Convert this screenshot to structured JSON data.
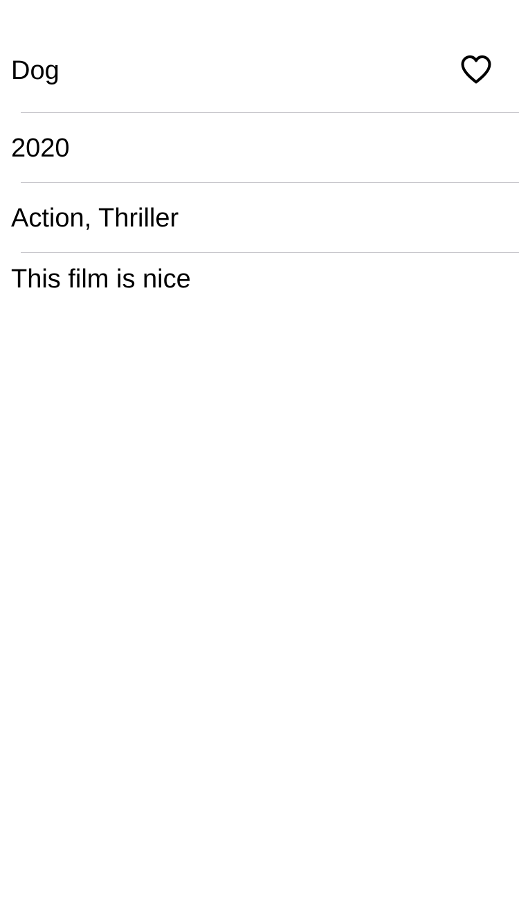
{
  "movie": {
    "title": "Dog",
    "year": "2020",
    "genres": "Action, Thriller",
    "description": "This film is nice"
  },
  "favorite": {
    "icon": "heart-outline-icon",
    "is_favorite": false,
    "color": "#000000"
  },
  "colors": {
    "background": "#ffffff",
    "text": "#000000",
    "separator": "#c8c7cc"
  }
}
